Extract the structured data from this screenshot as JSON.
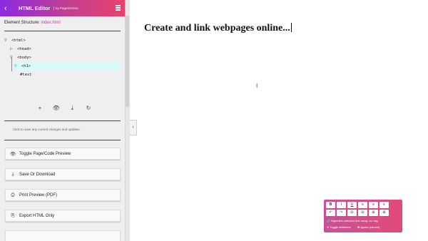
{
  "header": {
    "back_icon": "‹",
    "title": "HTML Editor",
    "separator": "|",
    "byline": "by PageSection"
  },
  "structure": {
    "label": "Element Structure:",
    "file": "index.html"
  },
  "tree": {
    "nodes": [
      {
        "tri": "▽",
        "tag": "<html>"
      },
      {
        "tri": "▷",
        "tag": "<head>"
      },
      {
        "tri": "▽",
        "tag": "<body>"
      },
      {
        "tri": "▽",
        "tag": "<h1>"
      },
      {
        "tri": "",
        "tag": "#text"
      }
    ]
  },
  "toolbar": {
    "add": "+",
    "preview": "👁",
    "download": "⤓",
    "refresh": "↻"
  },
  "hint": "Click to save any current changes and updates.",
  "buttons": {
    "toggle": {
      "icon": "👁",
      "label": "Toggle Page/Code Preview"
    },
    "save": {
      "icon": "⤓",
      "label": "Save Or Download"
    },
    "print": {
      "icon": "⎙",
      "label": "Print Preview (PDF)"
    },
    "export": {
      "icon": "⎘",
      "label": "Export HTML Only"
    }
  },
  "collapse": "‹",
  "preview": {
    "heading": "Create and link webpages online..."
  },
  "palette": {
    "row1": [
      "B",
      "I",
      "U",
      "≡",
      "≡",
      "≡"
    ],
    "row2": [
      "↶",
      "↷",
      "⊟",
      "⊟",
      "⊞",
      "⊞"
    ],
    "hyperlink": "Hyperlink selected text using <a> tag",
    "toggle_attr": "Toggle attributes",
    "ignore": "Ignore (cancel)"
  }
}
